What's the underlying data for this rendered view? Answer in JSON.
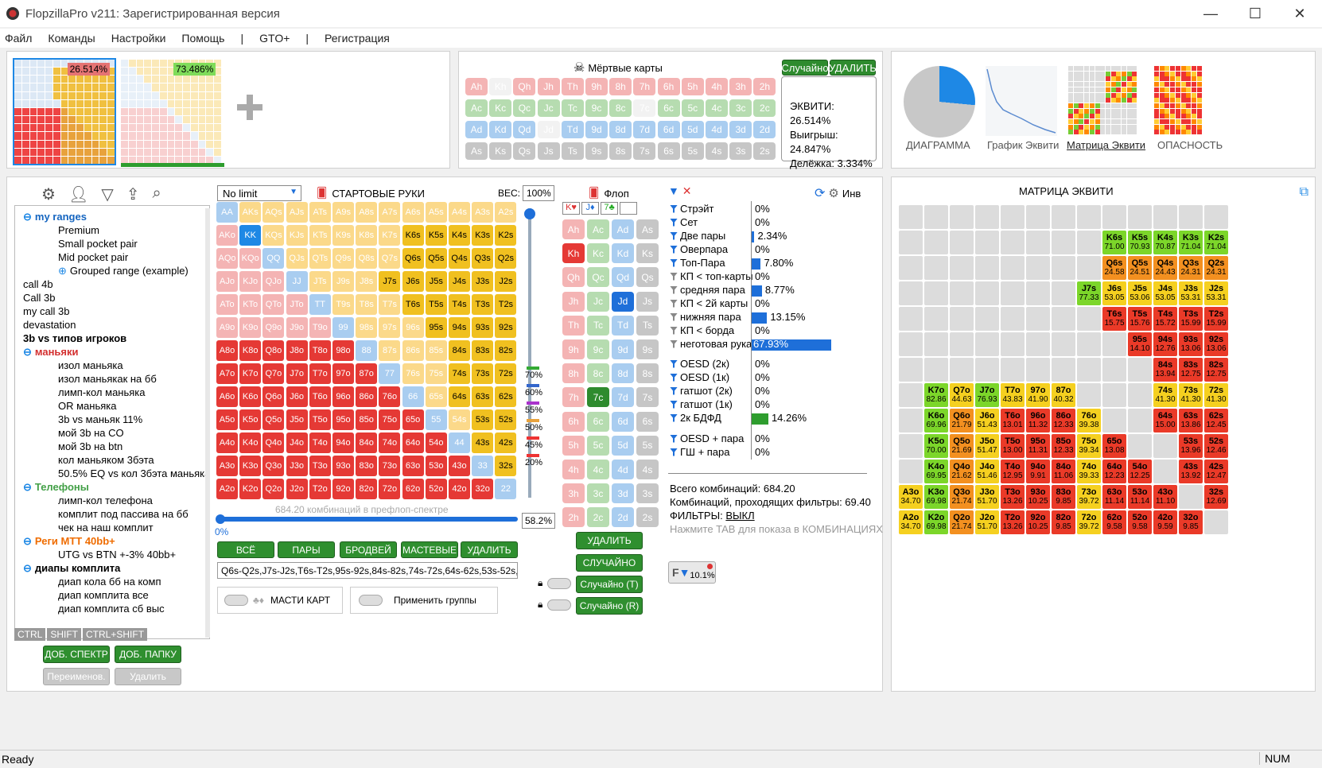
{
  "window": {
    "title": "FlopzillaPro v211: Зарегистрированная версия"
  },
  "menu": [
    "Файл",
    "Команды",
    "Настройки",
    "Помощь",
    "|",
    "GTO+",
    "|",
    "Регистрация"
  ],
  "ranges_top": {
    "player1_pct": "26.514%",
    "player2_pct": "73.486%"
  },
  "dead_cards": {
    "title": "Мёртвые карты",
    "random_label": "Случайно",
    "delete_label": "УДАЛИТЬ",
    "rows": [
      [
        "Ah",
        "Kh",
        "Qh",
        "Jh",
        "Th",
        "9h",
        "8h",
        "7h",
        "6h",
        "5h",
        "4h",
        "3h",
        "2h"
      ],
      [
        "Ac",
        "Kc",
        "Qc",
        "Jc",
        "Tc",
        "9c",
        "8c",
        "7c",
        "6c",
        "5c",
        "4c",
        "3c",
        "2c"
      ],
      [
        "Ad",
        "Kd",
        "Qd",
        "Jd",
        "Td",
        "9d",
        "8d",
        "7d",
        "6d",
        "5d",
        "4d",
        "3d",
        "2d"
      ],
      [
        "As",
        "Ks",
        "Qs",
        "Js",
        "Ts",
        "9s",
        "8s",
        "7s",
        "6s",
        "5s",
        "4s",
        "3s",
        "2s"
      ]
    ],
    "equity": "ЭКВИТИ: 26.514%",
    "win": "Выигрыш: 24.847%",
    "tie": "Делёжка: 3.334%"
  },
  "views": [
    "ДИАГРАММА",
    "График Эквити",
    "Матрица Эквити",
    "ОПАСНОСТЬ"
  ],
  "tree": {
    "items": [
      {
        "t": "my ranges",
        "level": 1,
        "color": "#1565c0",
        "bold": true,
        "toggle": "⊖"
      },
      {
        "t": "Premium",
        "level": 2
      },
      {
        "t": "Small pocket pair",
        "level": 2
      },
      {
        "t": "Mid pocket pair",
        "level": 2
      },
      {
        "t": "Grouped range (example)",
        "level": 2,
        "toggle": "⊕"
      },
      {
        "t": "call 4b",
        "level": 1
      },
      {
        "t": "Call 3b",
        "level": 1
      },
      {
        "t": "my call 3b",
        "level": 1
      },
      {
        "t": "devastation",
        "level": 1
      },
      {
        "t": "3b vs типов игроков",
        "level": 1,
        "bold": true
      },
      {
        "t": "маньяки",
        "level": 1,
        "color": "#d32f2f",
        "bold": true,
        "toggle": "⊖"
      },
      {
        "t": "изол маньяка",
        "level": 2
      },
      {
        "t": "изол маньякак на бб",
        "level": 2
      },
      {
        "t": "лимп-кол маньяка",
        "level": 2
      },
      {
        "t": "OR маньяка",
        "level": 2
      },
      {
        "t": "3b vs маньяк 11%",
        "level": 2
      },
      {
        "t": "мой 3b на CO",
        "level": 2
      },
      {
        "t": "мой 3b на btn",
        "level": 2
      },
      {
        "t": "кол маньяком 3бэта",
        "level": 2
      },
      {
        "t": "50.5% EQ vs кол 3бэта маньяка",
        "level": 2
      },
      {
        "t": "Телефоны",
        "level": 1,
        "color": "#43a047",
        "bold": true,
        "toggle": "⊖"
      },
      {
        "t": "лимп-кол телефона",
        "level": 2
      },
      {
        "t": "комплит под пассива на бб",
        "level": 2
      },
      {
        "t": "чек на наш комплит",
        "level": 2
      },
      {
        "t": "Реги МТТ 40bb+",
        "level": 1,
        "color": "#ef6c00",
        "bold": true,
        "toggle": "⊖"
      },
      {
        "t": "UTG vs BTN +-3% 40bb+",
        "level": 2
      },
      {
        "t": "диапы комплита",
        "level": 1,
        "bold": true,
        "toggle": "⊖"
      },
      {
        "t": "диап кола бб на комп",
        "level": 2
      },
      {
        "t": "диап комплита все",
        "level": 2
      },
      {
        "t": "диап комплита сб выс",
        "level": 2
      }
    ],
    "mod_keys": [
      "CTRL",
      "SHIFT",
      "CTRL+SHIFT"
    ],
    "add_range": "ДОБ. СПЕКТР",
    "add_folder": "ДОБ. ПАПКУ",
    "rename": "Переименов.",
    "delete": "Удалить"
  },
  "start_hands": {
    "limit": "No limit",
    "title": "СТАРТОВЫЕ РУКИ",
    "weight_label": "ВЕС:",
    "weight": "100%",
    "combos_text": "684.20 комбинаций в префлоп-спектре",
    "slider_min": "0%",
    "slider_value": "58.2%",
    "buttons": [
      "ВСЁ",
      "ПАРЫ",
      "БРОДВЕЙ",
      "МАСТЕВЫЕ",
      "УДАЛИТЬ"
    ],
    "range_text": "Q6s-Q2s,J7s-J2s,T6s-T2s,95s-92s,84s-82s,74s-72s,64s-62s,53s-52s,",
    "suits_toggle": "МАСТИ КАРТ",
    "groups_toggle": "Применить группы",
    "weight_marks": [
      "70%",
      "60%",
      "55%",
      "50%",
      "45%",
      "20%"
    ]
  },
  "flop": {
    "title": "Флоп",
    "selected_cards": [
      "K♥",
      "J♦",
      "7♣"
    ],
    "delete": "УДАЛИТЬ",
    "random": "СЛУЧАЙНО",
    "random_t": "Случайно (T)",
    "random_r": "Случайно (R)"
  },
  "stats": {
    "inv_label": "Инв",
    "rows": [
      {
        "label": "Стрэйт",
        "pct": "0%",
        "v": 0,
        "f": "b"
      },
      {
        "label": "Сет",
        "pct": "0%",
        "v": 0,
        "f": "b"
      },
      {
        "label": "Две пары",
        "pct": "2.34%",
        "v": 2.34,
        "f": "b"
      },
      {
        "label": "Оверпара",
        "pct": "0%",
        "v": 0,
        "f": "b"
      },
      {
        "label": "Топ-Пара",
        "pct": "7.80%",
        "v": 7.8,
        "f": "b"
      },
      {
        "label": "КП < топ-карты",
        "pct": "0%",
        "v": 0,
        "f": "g"
      },
      {
        "label": "средняя пара",
        "pct": "8.77%",
        "v": 8.77,
        "f": "g"
      },
      {
        "label": "КП < 2й карты",
        "pct": "0%",
        "v": 0,
        "f": "g"
      },
      {
        "label": "нижняя пара",
        "pct": "13.15%",
        "v": 13.15,
        "f": "g"
      },
      {
        "label": "КП < борда",
        "pct": "0%",
        "v": 0,
        "f": "g"
      },
      {
        "label": "неготовая рука",
        "pct": "67.93%",
        "v": 67.93,
        "f": "g"
      }
    ],
    "draws": [
      {
        "label": "OESD (2к)",
        "pct": "0%",
        "v": 0
      },
      {
        "label": "OESD (1к)",
        "pct": "0%",
        "v": 0
      },
      {
        "label": "гатшот (2к)",
        "pct": "0%",
        "v": 0
      },
      {
        "label": "гатшот (1к)",
        "pct": "0%",
        "v": 0
      },
      {
        "label": "2к БДФД",
        "pct": "14.26%",
        "v": 14.26,
        "green": true
      }
    ],
    "combos": [
      {
        "label": "OESD + пара",
        "pct": "0%",
        "v": 0
      },
      {
        "label": "ГШ + пара",
        "pct": "0%",
        "v": 0
      }
    ],
    "total": "Всего комбинаций: 684.20",
    "passing": "Комбинаций, проходящих фильтры: 69.40",
    "filters_label": "ФИЛЬТРЫ:",
    "filters_value": "ВЫКЛ",
    "hint": "Нажмите TAB для показа в КОМБИНАЦИЯХ",
    "filter_badge": "10.1%"
  },
  "equity_matrix": {
    "title": "МАТРИЦА ЭКВИТИ",
    "cells": [
      {
        "r": 1,
        "c": 8,
        "h": "K6s",
        "v": "71.00",
        "k": "g"
      },
      {
        "r": 1,
        "c": 9,
        "h": "K5s",
        "v": "70.93",
        "k": "g"
      },
      {
        "r": 1,
        "c": 10,
        "h": "K4s",
        "v": "70.87",
        "k": "g"
      },
      {
        "r": 1,
        "c": 11,
        "h": "K3s",
        "v": "71.04",
        "k": "g"
      },
      {
        "r": 1,
        "c": 12,
        "h": "K2s",
        "v": "71.04",
        "k": "g"
      },
      {
        "r": 2,
        "c": 8,
        "h": "Q6s",
        "v": "24.58",
        "k": "o"
      },
      {
        "r": 2,
        "c": 9,
        "h": "Q5s",
        "v": "24.51",
        "k": "o"
      },
      {
        "r": 2,
        "c": 10,
        "h": "Q4s",
        "v": "24.43",
        "k": "o"
      },
      {
        "r": 2,
        "c": 11,
        "h": "Q3s",
        "v": "24.31",
        "k": "o"
      },
      {
        "r": 2,
        "c": 12,
        "h": "Q2s",
        "v": "24.31",
        "k": "o"
      },
      {
        "r": 3,
        "c": 7,
        "h": "J7s",
        "v": "77.33",
        "k": "g"
      },
      {
        "r": 3,
        "c": 8,
        "h": "J6s",
        "v": "53.05",
        "k": "y"
      },
      {
        "r": 3,
        "c": 9,
        "h": "J5s",
        "v": "53.06",
        "k": "y"
      },
      {
        "r": 3,
        "c": 10,
        "h": "J4s",
        "v": "53.05",
        "k": "y"
      },
      {
        "r": 3,
        "c": 11,
        "h": "J3s",
        "v": "53.31",
        "k": "y"
      },
      {
        "r": 3,
        "c": 12,
        "h": "J2s",
        "v": "53.31",
        "k": "y"
      },
      {
        "r": 4,
        "c": 8,
        "h": "T6s",
        "v": "15.75",
        "k": "r"
      },
      {
        "r": 4,
        "c": 9,
        "h": "T5s",
        "v": "15.76",
        "k": "r"
      },
      {
        "r": 4,
        "c": 10,
        "h": "T4s",
        "v": "15.72",
        "k": "r"
      },
      {
        "r": 4,
        "c": 11,
        "h": "T3s",
        "v": "15.99",
        "k": "r"
      },
      {
        "r": 4,
        "c": 12,
        "h": "T2s",
        "v": "15.99",
        "k": "r"
      },
      {
        "r": 5,
        "c": 9,
        "h": "95s",
        "v": "14.10",
        "k": "r"
      },
      {
        "r": 5,
        "c": 10,
        "h": "94s",
        "v": "12.76",
        "k": "r"
      },
      {
        "r": 5,
        "c": 11,
        "h": "93s",
        "v": "13.06",
        "k": "r"
      },
      {
        "r": 5,
        "c": 12,
        "h": "92s",
        "v": "13.06",
        "k": "r"
      },
      {
        "r": 6,
        "c": 10,
        "h": "84s",
        "v": "13.94",
        "k": "r"
      },
      {
        "r": 6,
        "c": 11,
        "h": "83s",
        "v": "12.75",
        "k": "r"
      },
      {
        "r": 6,
        "c": 12,
        "h": "82s",
        "v": "12.75",
        "k": "r"
      },
      {
        "r": 7,
        "c": 1,
        "h": "K7o",
        "v": "82.86",
        "k": "g"
      },
      {
        "r": 7,
        "c": 2,
        "h": "Q7o",
        "v": "44.63",
        "k": "y"
      },
      {
        "r": 7,
        "c": 3,
        "h": "J7o",
        "v": "76.93",
        "k": "g"
      },
      {
        "r": 7,
        "c": 4,
        "h": "T7o",
        "v": "43.83",
        "k": "y"
      },
      {
        "r": 7,
        "c": 5,
        "h": "97o",
        "v": "41.90",
        "k": "y"
      },
      {
        "r": 7,
        "c": 6,
        "h": "87o",
        "v": "40.32",
        "k": "y"
      },
      {
        "r": 7,
        "c": 10,
        "h": "74s",
        "v": "41.30",
        "k": "y"
      },
      {
        "r": 7,
        "c": 11,
        "h": "73s",
        "v": "41.30",
        "k": "y"
      },
      {
        "r": 7,
        "c": 12,
        "h": "72s",
        "v": "41.30",
        "k": "y"
      },
      {
        "r": 8,
        "c": 1,
        "h": "K6o",
        "v": "69.96",
        "k": "g"
      },
      {
        "r": 8,
        "c": 2,
        "h": "Q6o",
        "v": "21.79",
        "k": "o"
      },
      {
        "r": 8,
        "c": 3,
        "h": "J6o",
        "v": "51.43",
        "k": "y"
      },
      {
        "r": 8,
        "c": 4,
        "h": "T6o",
        "v": "13.01",
        "k": "r"
      },
      {
        "r": 8,
        "c": 5,
        "h": "96o",
        "v": "11.32",
        "k": "r"
      },
      {
        "r": 8,
        "c": 6,
        "h": "86o",
        "v": "12.33",
        "k": "r"
      },
      {
        "r": 8,
        "c": 7,
        "h": "76o",
        "v": "39.38",
        "k": "y"
      },
      {
        "r": 8,
        "c": 10,
        "h": "64s",
        "v": "15.00",
        "k": "r"
      },
      {
        "r": 8,
        "c": 11,
        "h": "63s",
        "v": "13.86",
        "k": "r"
      },
      {
        "r": 8,
        "c": 12,
        "h": "62s",
        "v": "12.45",
        "k": "r"
      },
      {
        "r": 9,
        "c": 1,
        "h": "K5o",
        "v": "70.00",
        "k": "g"
      },
      {
        "r": 9,
        "c": 2,
        "h": "Q5o",
        "v": "21.69",
        "k": "o"
      },
      {
        "r": 9,
        "c": 3,
        "h": "J5o",
        "v": "51.47",
        "k": "y"
      },
      {
        "r": 9,
        "c": 4,
        "h": "T5o",
        "v": "13.00",
        "k": "r"
      },
      {
        "r": 9,
        "c": 5,
        "h": "95o",
        "v": "11.31",
        "k": "r"
      },
      {
        "r": 9,
        "c": 6,
        "h": "85o",
        "v": "12.33",
        "k": "r"
      },
      {
        "r": 9,
        "c": 7,
        "h": "75o",
        "v": "39.34",
        "k": "y"
      },
      {
        "r": 9,
        "c": 8,
        "h": "65o",
        "v": "13.08",
        "k": "r"
      },
      {
        "r": 9,
        "c": 11,
        "h": "53s",
        "v": "13.96",
        "k": "r"
      },
      {
        "r": 9,
        "c": 12,
        "h": "52s",
        "v": "12.46",
        "k": "r"
      },
      {
        "r": 10,
        "c": 1,
        "h": "K4o",
        "v": "69.95",
        "k": "g"
      },
      {
        "r": 10,
        "c": 2,
        "h": "Q4o",
        "v": "21.62",
        "k": "o"
      },
      {
        "r": 10,
        "c": 3,
        "h": "J4o",
        "v": "51.46",
        "k": "y"
      },
      {
        "r": 10,
        "c": 4,
        "h": "T4o",
        "v": "12.95",
        "k": "r"
      },
      {
        "r": 10,
        "c": 5,
        "h": "94o",
        "v": "9.91",
        "k": "r"
      },
      {
        "r": 10,
        "c": 6,
        "h": "84o",
        "v": "11.06",
        "k": "r"
      },
      {
        "r": 10,
        "c": 7,
        "h": "74o",
        "v": "39.33",
        "k": "y"
      },
      {
        "r": 10,
        "c": 8,
        "h": "64o",
        "v": "12.23",
        "k": "r"
      },
      {
        "r": 10,
        "c": 9,
        "h": "54o",
        "v": "12.25",
        "k": "r"
      },
      {
        "r": 10,
        "c": 11,
        "h": "43s",
        "v": "13.92",
        "k": "r"
      },
      {
        "r": 10,
        "c": 12,
        "h": "42s",
        "v": "12.47",
        "k": "r"
      },
      {
        "r": 11,
        "c": 0,
        "h": "A3o",
        "v": "34.70",
        "k": "y"
      },
      {
        "r": 11,
        "c": 1,
        "h": "K3o",
        "v": "69.98",
        "k": "g"
      },
      {
        "r": 11,
        "c": 2,
        "h": "Q3o",
        "v": "21.74",
        "k": "o"
      },
      {
        "r": 11,
        "c": 3,
        "h": "J3o",
        "v": "51.70",
        "k": "y"
      },
      {
        "r": 11,
        "c": 4,
        "h": "T3o",
        "v": "13.26",
        "k": "r"
      },
      {
        "r": 11,
        "c": 5,
        "h": "93o",
        "v": "10.25",
        "k": "r"
      },
      {
        "r": 11,
        "c": 6,
        "h": "83o",
        "v": "9.85",
        "k": "r"
      },
      {
        "r": 11,
        "c": 7,
        "h": "73o",
        "v": "39.72",
        "k": "y"
      },
      {
        "r": 11,
        "c": 8,
        "h": "63o",
        "v": "11.14",
        "k": "r"
      },
      {
        "r": 11,
        "c": 9,
        "h": "53o",
        "v": "11.14",
        "k": "r"
      },
      {
        "r": 11,
        "c": 10,
        "h": "43o",
        "v": "11.10",
        "k": "r"
      },
      {
        "r": 11,
        "c": 12,
        "h": "32s",
        "v": "12.69",
        "k": "r"
      },
      {
        "r": 12,
        "c": 0,
        "h": "A2o",
        "v": "34.70",
        "k": "y"
      },
      {
        "r": 12,
        "c": 1,
        "h": "K2o",
        "v": "69.98",
        "k": "g"
      },
      {
        "r": 12,
        "c": 2,
        "h": "Q2o",
        "v": "21.74",
        "k": "o"
      },
      {
        "r": 12,
        "c": 3,
        "h": "J2o",
        "v": "51.70",
        "k": "y"
      },
      {
        "r": 12,
        "c": 4,
        "h": "T2o",
        "v": "13.26",
        "k": "r"
      },
      {
        "r": 12,
        "c": 5,
        "h": "92o",
        "v": "10.25",
        "k": "r"
      },
      {
        "r": 12,
        "c": 6,
        "h": "82o",
        "v": "9.85",
        "k": "r"
      },
      {
        "r": 12,
        "c": 7,
        "h": "72o",
        "v": "39.72",
        "k": "y"
      },
      {
        "r": 12,
        "c": 8,
        "h": "62o",
        "v": "9.58",
        "k": "r"
      },
      {
        "r": 12,
        "c": 9,
        "h": "52o",
        "v": "9.58",
        "k": "r"
      },
      {
        "r": 12,
        "c": 10,
        "h": "42o",
        "v": "9.59",
        "k": "r"
      },
      {
        "r": 12,
        "c": 11,
        "h": "32o",
        "v": "9.85",
        "k": "r"
      }
    ]
  },
  "status": {
    "left": "Ready",
    "right": "NUM"
  }
}
